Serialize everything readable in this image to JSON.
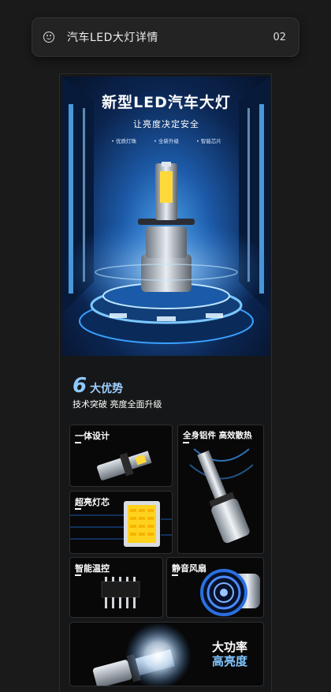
{
  "header": {
    "title": "汽车LED大灯详情",
    "index": "02",
    "icon": "smile-icon"
  },
  "hero": {
    "title": "新型LED汽车大灯",
    "subtitle": "让亮度决定安全",
    "tags": [
      "优质灯珠",
      "全新升级",
      "智能芯片"
    ]
  },
  "advantages": {
    "number": "6",
    "label": "大优势",
    "subtitle": "技术突破 亮度全面升级",
    "cards": [
      {
        "title": "一体设计"
      },
      {
        "title": "全身铝件 高效散热"
      },
      {
        "title": "超亮灯芯"
      },
      {
        "title": "智能温控"
      },
      {
        "title": "静音风扇"
      },
      {
        "title_line1": "大功率",
        "title_line2": "高亮度"
      }
    ]
  },
  "colors": {
    "accent": "#7fc4ff",
    "background": "#1a1a1a"
  }
}
